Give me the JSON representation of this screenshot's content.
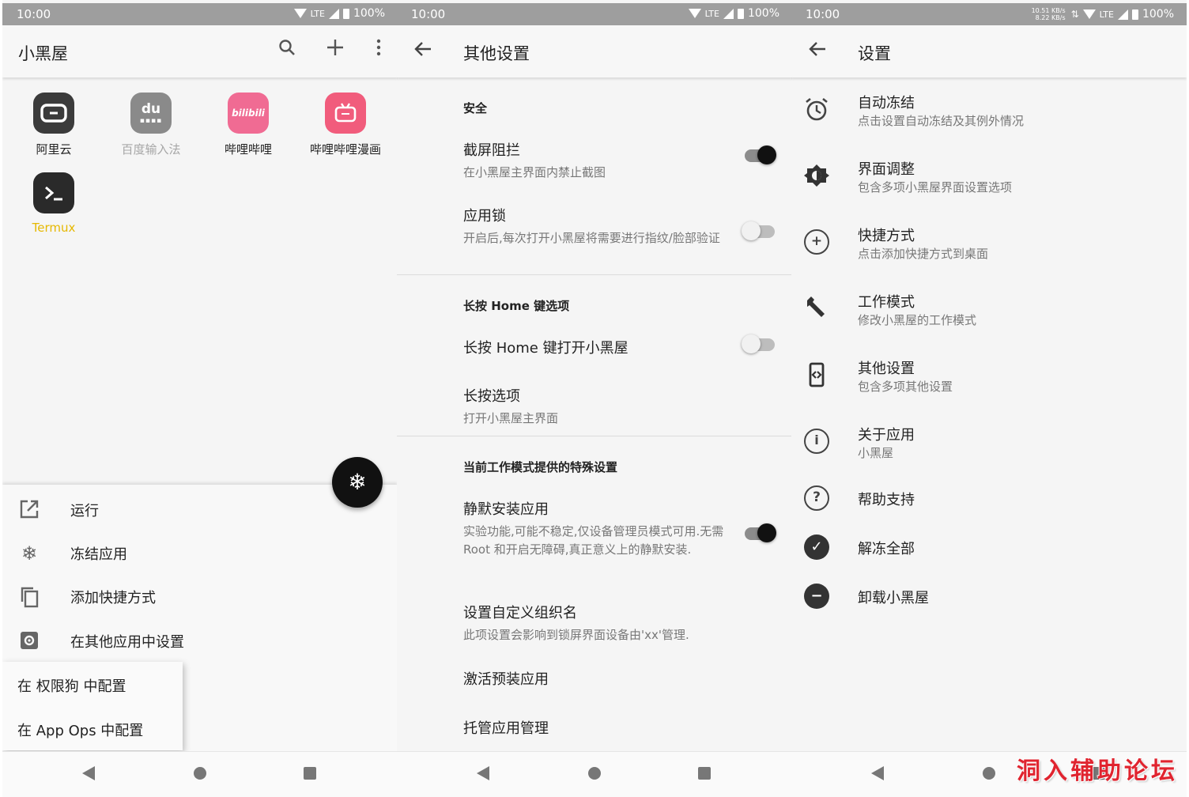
{
  "status": {
    "time": "10:00",
    "network": "LTE",
    "battery": "100%",
    "speed_up": "10.51 KB/s",
    "speed_down": "8.22 KB/s"
  },
  "panel1": {
    "title": "小黑屋",
    "apps": [
      {
        "label": "阿里云",
        "color": "#3b3b3b",
        "label_color": "#222222"
      },
      {
        "label": "百度输入法",
        "color": "#8a8a8a",
        "label_color": "#a6a6a6",
        "icon_text": "du"
      },
      {
        "label": "哔哩哔哩",
        "color": "#f06b93",
        "label_color": "#222222",
        "icon_text": "bilibili"
      },
      {
        "label": "哔哩哔哩漫画",
        "color": "#f15c7c",
        "label_color": "#222222"
      },
      {
        "label": "Termux",
        "color": "#2a2a2a",
        "label_color": "#e6b800"
      }
    ],
    "sheet": [
      {
        "label": "运行",
        "icon": "open-external-icon"
      },
      {
        "label": "冻结应用",
        "icon": "snowflake-icon"
      },
      {
        "label": "添加快捷方式",
        "icon": "copy-icon"
      },
      {
        "label": "在其他应用中设置",
        "icon": "settings-box-icon"
      }
    ],
    "popup": [
      "在 权限狗 中配置",
      "在 App Ops 中配置"
    ]
  },
  "panel2": {
    "title": "其他设置",
    "sec_security": "安全",
    "screenshot_block": {
      "title": "截屏阻拦",
      "summary": "在小黑屋主界面内禁止截图",
      "on": true
    },
    "app_lock": {
      "title": "应用锁",
      "summary": "开启后,每次打开小黑屋将需要进行指纹/脸部验证",
      "on": false
    },
    "sec_home": "长按 Home 键选项",
    "home_open": {
      "title": "长按 Home 键打开小黑屋",
      "on": false
    },
    "long_press": {
      "title": "长按选项",
      "summary": "打开小黑屋主界面"
    },
    "sec_mode": "当前工作模式提供的特殊设置",
    "silent_install": {
      "title": "静默安装应用",
      "summary": "实验功能,可能不稳定,仅设备管理员模式可用.无需 Root 和开启无障碍,真正意义上的静默安装.",
      "on": true
    },
    "org_name": {
      "title": "设置自定义组织名",
      "summary": "此项设置会影响到锁屏界面设备由'xx'管理."
    },
    "activate": {
      "title": "激活预装应用"
    },
    "managed": {
      "title": "托管应用管理"
    }
  },
  "panel3": {
    "title": "设置",
    "items": [
      {
        "title": "自动冻结",
        "summary": "点击设置自动冻结及其例外情况"
      },
      {
        "title": "界面调整",
        "summary": "包含多项小黑屋界面设置选项"
      },
      {
        "title": "快捷方式",
        "summary": "点击添加快捷方式到桌面"
      },
      {
        "title": "工作模式",
        "summary": "修改小黑屋的工作模式"
      },
      {
        "title": "其他设置",
        "summary": "包含多项其他设置"
      },
      {
        "title": "关于应用",
        "summary": "小黑屋"
      },
      {
        "title": "帮助支持"
      },
      {
        "title": "解冻全部"
      },
      {
        "title": "卸载小黑屋"
      }
    ]
  },
  "watermark": "洞入辅助论坛"
}
